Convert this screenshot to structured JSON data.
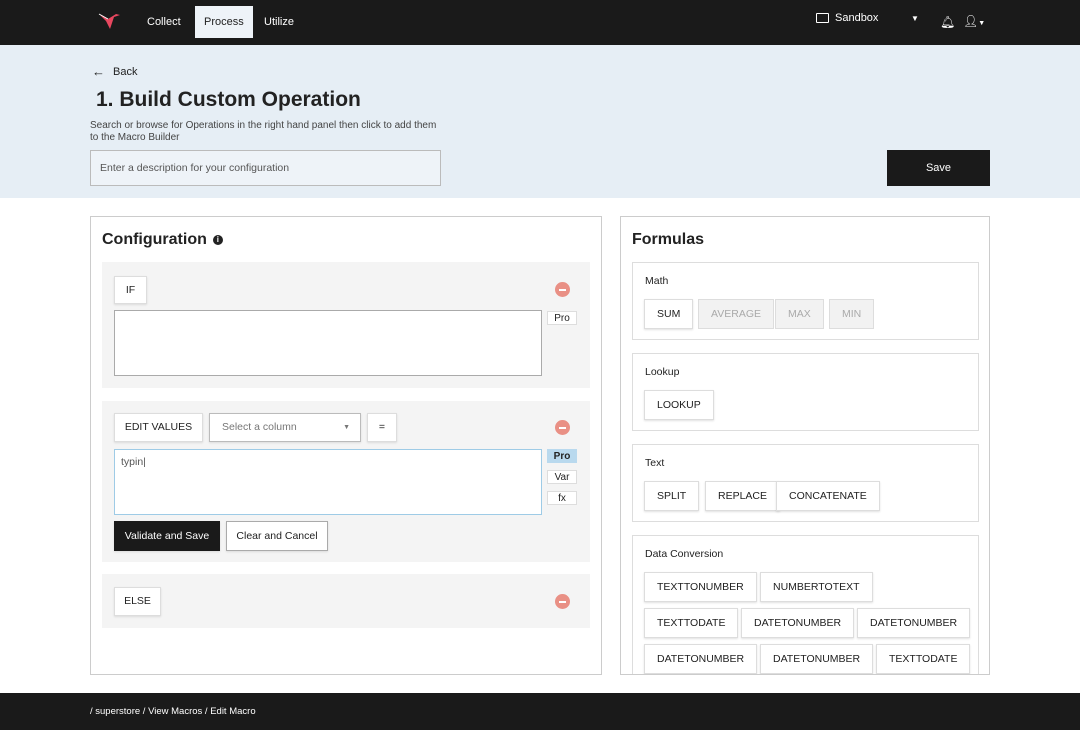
{
  "nav": {
    "items": [
      "Collect",
      "Process",
      "Utilize"
    ],
    "workspace": "Sandbox"
  },
  "header": {
    "back": "Back",
    "title": "1. Build Custom Operation",
    "subtitle": "Search or browse for Operations in the right hand panel then click to add them to the Macro Builder",
    "desc_placeholder": "Enter a description for your configuration",
    "save": "Save"
  },
  "config": {
    "title": "Configuration",
    "if_label": "IF",
    "else_label": "ELSE",
    "edit_label": "EDIT VALUES",
    "select_placeholder": "Select a column",
    "operator": "=",
    "input_value": "typin|",
    "side_buttons": [
      "Pro",
      "Var",
      "fx"
    ],
    "validate": "Validate and Save",
    "clear": "Clear and Cancel"
  },
  "formulas": {
    "title": "Formulas",
    "groups": [
      {
        "title": "Math",
        "items": [
          "SUM",
          "AVERAGE",
          "MAX",
          "MIN"
        ]
      },
      {
        "title": "Lookup",
        "items": [
          "LOOKUP"
        ]
      },
      {
        "title": "Text",
        "items": [
          "SPLIT",
          "REPLACE",
          "CONCATENATE"
        ]
      },
      {
        "title": "Data Conversion",
        "items": [
          "TEXTTONUMBER",
          "NUMBERTOTEXT",
          "TEXTTODATE",
          "DATETONUMBER",
          "DATETONUMBER",
          "DATETONUMBER",
          "DATETONUMBER",
          "TEXTTODATE"
        ]
      }
    ]
  },
  "footer": {
    "breadcrumb": "/ superstore / View Macros / Edit Macro"
  },
  "colors": {
    "accent": "#e8475f",
    "dark": "#1a1a1a",
    "active_pro": "#b9d9ee"
  }
}
